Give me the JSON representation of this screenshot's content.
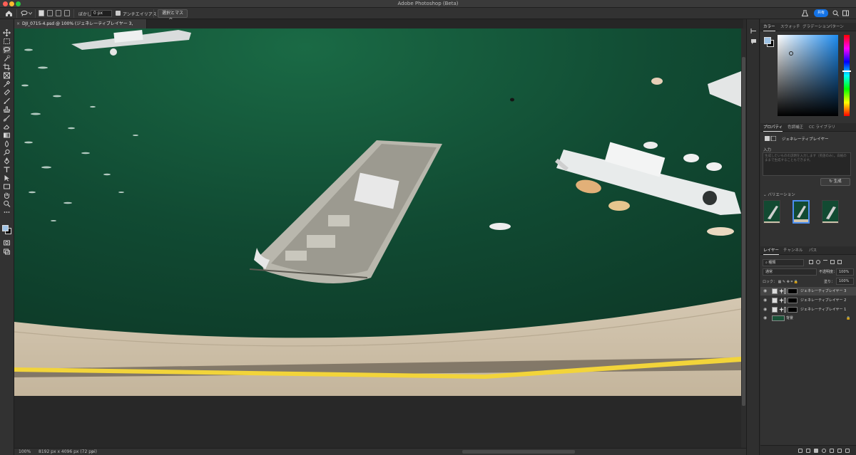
{
  "window": {
    "title": "Adobe Photoshop (Beta)"
  },
  "colors": {
    "accent": "#1473e6",
    "water": "#124a32",
    "selection": "#4b8ef0"
  },
  "options_bar": {
    "feather_label": "ぼかし：",
    "feather_value": "0 px",
    "antialias_label": "アンチエイリアス",
    "select_mask_button": "選択とマスク...",
    "share_button": "共有"
  },
  "document": {
    "tab_title": "DJI_0715-4.psd @ 100% (ジェネレーティブレイヤー 3, RGB/8) *",
    "close_glyph": "×"
  },
  "status_bar": {
    "zoom": "100%",
    "dimensions": "8192 px x 4096 px (72 ppi)",
    "arrow": "›"
  },
  "toolbar": {
    "tools": [
      "move-tool",
      "artboard-tool",
      "lasso-tool",
      "quick-selection-tool",
      "crop-tool",
      "frame-tool",
      "eyedropper-tool",
      "spot-healing-tool",
      "brush-tool",
      "clone-stamp-tool",
      "history-brush-tool",
      "eraser-tool",
      "gradient-tool",
      "blur-tool",
      "dodge-tool",
      "pen-tool",
      "type-tool",
      "path-selection-tool",
      "rectangle-tool",
      "hand-tool",
      "zoom-tool",
      "more-tools"
    ]
  },
  "color_panel": {
    "tabs": [
      "カラー",
      "スウォッチ",
      "グラデーション",
      "パターン"
    ]
  },
  "properties_panel": {
    "tabs": [
      "プロパティ",
      "色調補正",
      "CC ライブラリ"
    ],
    "layer_type": "ジェネレーティブレイヤー",
    "prompt_label": "入力",
    "prompt_placeholder": "生成したいものの説明を入力します（英語のみ）。白紙のままで生成することもできます。",
    "generate_button": "生成",
    "variations_label": "バリエーション"
  },
  "layers_panel": {
    "tabs": [
      "レイヤー",
      "チャンネル",
      "パス"
    ],
    "filter_kind": "種類",
    "blend_mode": "通常",
    "opacity_label": "不透明度：",
    "opacity_value": "100%",
    "lock_label": "ロック：",
    "fill_label": "塗り：",
    "fill_value": "100%",
    "layers": [
      {
        "name": "ジェネレーティブレイヤー 3",
        "selected": true
      },
      {
        "name": "ジェネレーティブレイヤー 2",
        "selected": false
      },
      {
        "name": "ジェネレーティブレイヤー 1",
        "selected": false
      },
      {
        "name": "背景",
        "selected": false
      }
    ],
    "eye_glyph": "👁"
  }
}
